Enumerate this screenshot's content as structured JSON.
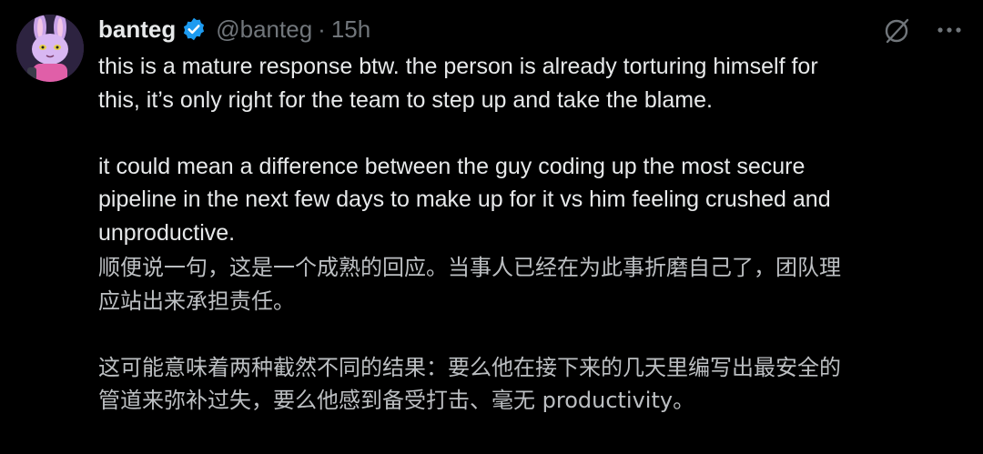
{
  "author": {
    "display_name": "banteg",
    "handle": "@banteg",
    "separator": "·",
    "timestamp": "15h",
    "verified": true,
    "avatar_icon": "bunny-avatar-icon"
  },
  "actions": {
    "grok_icon": "slashed-circle-icon",
    "more_icon": "more-dots-icon"
  },
  "tweet": {
    "paragraphs": [
      "this is a mature response btw. the person is already torturing himself for\nthis, it’s only right for the team to step up and take the blame.",
      "it could mean a difference between the guy coding up the most secure\npipeline in the next few days to make up for it vs him feeling crushed and\nunproductive."
    ]
  },
  "translation": {
    "paragraphs": [
      "顺便说一句，这是一个成熟的回应。当事人已经在为此事折磨自己了，团队理\n应站出来承担责任。",
      "这可能意味着两种截然不同的结果：要么他在接下来的几天里编写出最安全的\n管道来弥补过失，要么他感到备受打击、毫无 productivity。"
    ]
  },
  "colors": {
    "background": "#000000",
    "text": "#e7e9ea",
    "secondary": "#71767b",
    "verified_badge": "#1d9bf0"
  }
}
